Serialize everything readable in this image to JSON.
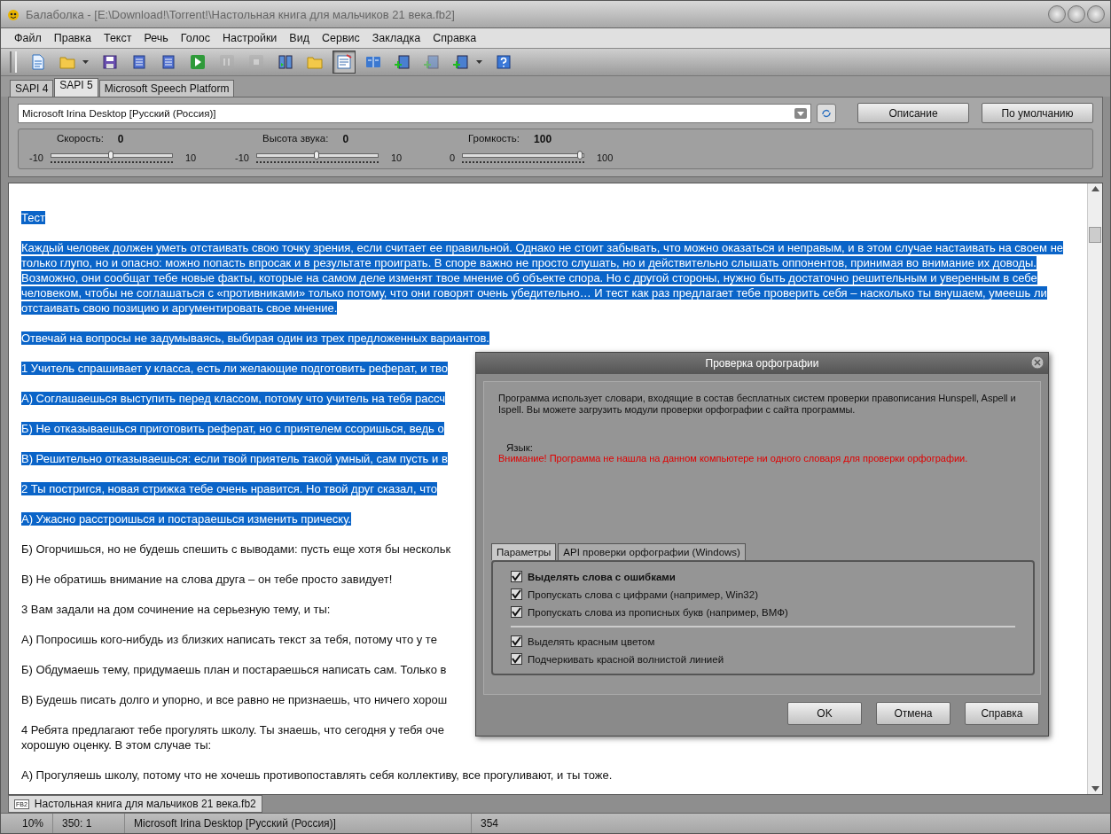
{
  "window": {
    "title": "Балаболка - [E:\\Download!\\Torrent!\\Настольная книга для мальчиков 21 века.fb2]"
  },
  "menu": [
    "Файл",
    "Правка",
    "Текст",
    "Речь",
    "Голос",
    "Настройки",
    "Вид",
    "Сервис",
    "Закладка",
    "Справка"
  ],
  "toolbar": [
    {
      "kind": "new",
      "disabled": false,
      "pressed": false
    },
    {
      "kind": "open",
      "disabled": false,
      "pressed": false
    },
    {
      "kind": "caret",
      "disabled": false,
      "pressed": false
    },
    {
      "kind": "save",
      "disabled": false,
      "pressed": false
    },
    {
      "kind": "export",
      "disabled": false,
      "pressed": false
    },
    {
      "kind": "export",
      "disabled": false,
      "pressed": false
    },
    {
      "kind": "play",
      "disabled": false,
      "pressed": false
    },
    {
      "kind": "pause",
      "disabled": true,
      "pressed": false
    },
    {
      "kind": "stop",
      "disabled": true,
      "pressed": false
    },
    {
      "kind": "split",
      "disabled": false,
      "pressed": false
    },
    {
      "kind": "open",
      "disabled": false,
      "pressed": false
    },
    {
      "kind": "note",
      "disabled": false,
      "pressed": true
    },
    {
      "kind": "book",
      "disabled": false,
      "pressed": false
    },
    {
      "kind": "addbook",
      "disabled": false,
      "pressed": false
    },
    {
      "kind": "addbook",
      "disabled": true,
      "pressed": false
    },
    {
      "kind": "addbook",
      "disabled": false,
      "pressed": false
    },
    {
      "kind": "caret",
      "disabled": false,
      "pressed": false
    },
    {
      "kind": "help",
      "disabled": false,
      "pressed": false
    }
  ],
  "engine_tabs": [
    {
      "label": "SAPI 4",
      "selected": false
    },
    {
      "label": "SAPI 5",
      "selected": true
    },
    {
      "label": "Microsoft Speech Platform",
      "selected": false
    }
  ],
  "voice": {
    "value": "Microsoft Irina Desktop [Русский (Россия)]",
    "buttons": [
      "Описание",
      "По умолчанию"
    ]
  },
  "sliders": [
    {
      "label": "Скорость:",
      "reading": "0",
      "min": "-10",
      "max": "10",
      "level": 0.5
    },
    {
      "label": "Высота звука:",
      "reading": "0",
      "min": "-10",
      "max": "10",
      "level": 0.5
    },
    {
      "label": "Громкость:",
      "reading": "100",
      "min": "0",
      "max": "100",
      "level": 1
    }
  ],
  "document": [
    {
      "text": "Тест",
      "selected": true
    },
    {
      "text": "Каждый человек должен уметь отстаивать свою точку зрения, если считает ее правильной. Однако не стоит забывать, что можно оказаться и неправым, и в этом случае настаивать на своем не только глупо, но и опасно: можно попасть впросак и в результате проиграть. В споре важно не просто слушать, но и действительно слышать оппонентов, принимая во внимание их доводы. Возможно, они сообщат тебе новые факты, которые на самом деле изменят твое мнение об объекте спора. Но с другой стороны, нужно быть достаточно решительным и уверенным в себе человеком, чтобы не соглашаться с «противниками» только потому, что они говорят очень убедительно… И тест как раз предлагает тебе проверить себя – насколько ты внушаем, умеешь ли отстаивать свою позицию и аргументировать свое мнение.",
      "selected": true
    },
    {
      "text": "Отвечай на вопросы не задумываясь, выбирая один из трех предложенных вариантов.",
      "selected": true
    },
    {
      "text": "1 Учитель спрашивает у класса, есть ли желающие подготовить реферат, и тво",
      "selected": true
    },
    {
      "text": "А) Соглашаешься выступить перед классом, потому что учитель на тебя рассч",
      "selected": true
    },
    {
      "text": "Б) Не отказываешься приготовить реферат, но с приятелем ссоришься, ведь о",
      "selected": true
    },
    {
      "text": "В) Решительно отказываешься: если твой приятель такой умный, сам пусть и в",
      "selected": true
    },
    {
      "text": "2 Ты постригся, новая стрижка тебе очень нравится. Но твой друг сказал, что",
      "selected": true
    },
    {
      "text": "А) Ужасно расстроишься и постараешься изменить прическу.",
      "selected": true
    },
    {
      "text": "Б) Огорчишься, но не будешь спешить с выводами: пусть еще хотя бы нескольк",
      "selected": false
    },
    {
      "text": "В) Не обратишь внимание на слова друга – он тебе просто завидует!",
      "selected": false
    },
    {
      "text": "3 Вам задали на дом сочинение на серьезную тему, и ты:",
      "selected": false
    },
    {
      "text": "А) Попросишь кого-нибудь из близких написать текст за тебя, потому что у те",
      "selected": false
    },
    {
      "text": "Б) Обдумаешь тему, придумаешь план и постараешься написать сам. Только в",
      "selected": false
    },
    {
      "text": "В) Будешь писать долго и упорно, и все равно не признаешь, что ничего хорош",
      "selected": false
    },
    {
      "text": "4 Ребята предлагают тебе прогулять школу. Ты знаешь, что сегодня у тебя оче",
      "selected": false
    },
    {
      "text": "хорошую оценку. В этом случае ты:",
      "selected": false
    },
    {
      "text": "А) Прогуляешь школу, потому что не хочешь противопоставлять себя коллективу, все прогуливают, и ты тоже.",
      "selected": false
    }
  ],
  "document_tab": {
    "label": "Настольная книга для мальчиков 21 века.fb2",
    "badge": "FB2"
  },
  "status_bar": [
    "10%",
    "350:   1",
    "Microsoft Irina Desktop [Русский (Россия)]",
    "354"
  ],
  "dialog": {
    "title": "Проверка орфографии",
    "info": "Программа использует словари, входящие в состав бесплатных систем проверки правописания Hunspell, Aspell и Ispell. Вы можете загрузить модули проверки орфографии с сайта программы.",
    "language_label": "Язык:",
    "warning": "Внимание! Программа не нашла на данном компьютере ни одного словаря для проверки орфографии.",
    "tabs": [
      {
        "label": "Параметры",
        "selected": true
      },
      {
        "label": "API проверки орфографии (Windows)",
        "selected": false
      }
    ],
    "options": [
      {
        "label": "Выделять слова с ошибками",
        "checked": true,
        "bold": true
      },
      {
        "label": "Пропускать слова с цифрами (например, Win32)",
        "checked": true,
        "bold": false
      },
      {
        "label": "Пропускать слова из прописных букв (например, ВМФ)",
        "checked": true,
        "bold": false
      }
    ],
    "highlight_options": [
      {
        "label": "Выделять красным цветом",
        "checked": true,
        "bold": false
      },
      {
        "label": "Подчеркивать красной волнистой линией",
        "checked": true,
        "bold": false
      }
    ],
    "buttons": [
      "OK",
      "Отмена",
      "Справка"
    ]
  }
}
